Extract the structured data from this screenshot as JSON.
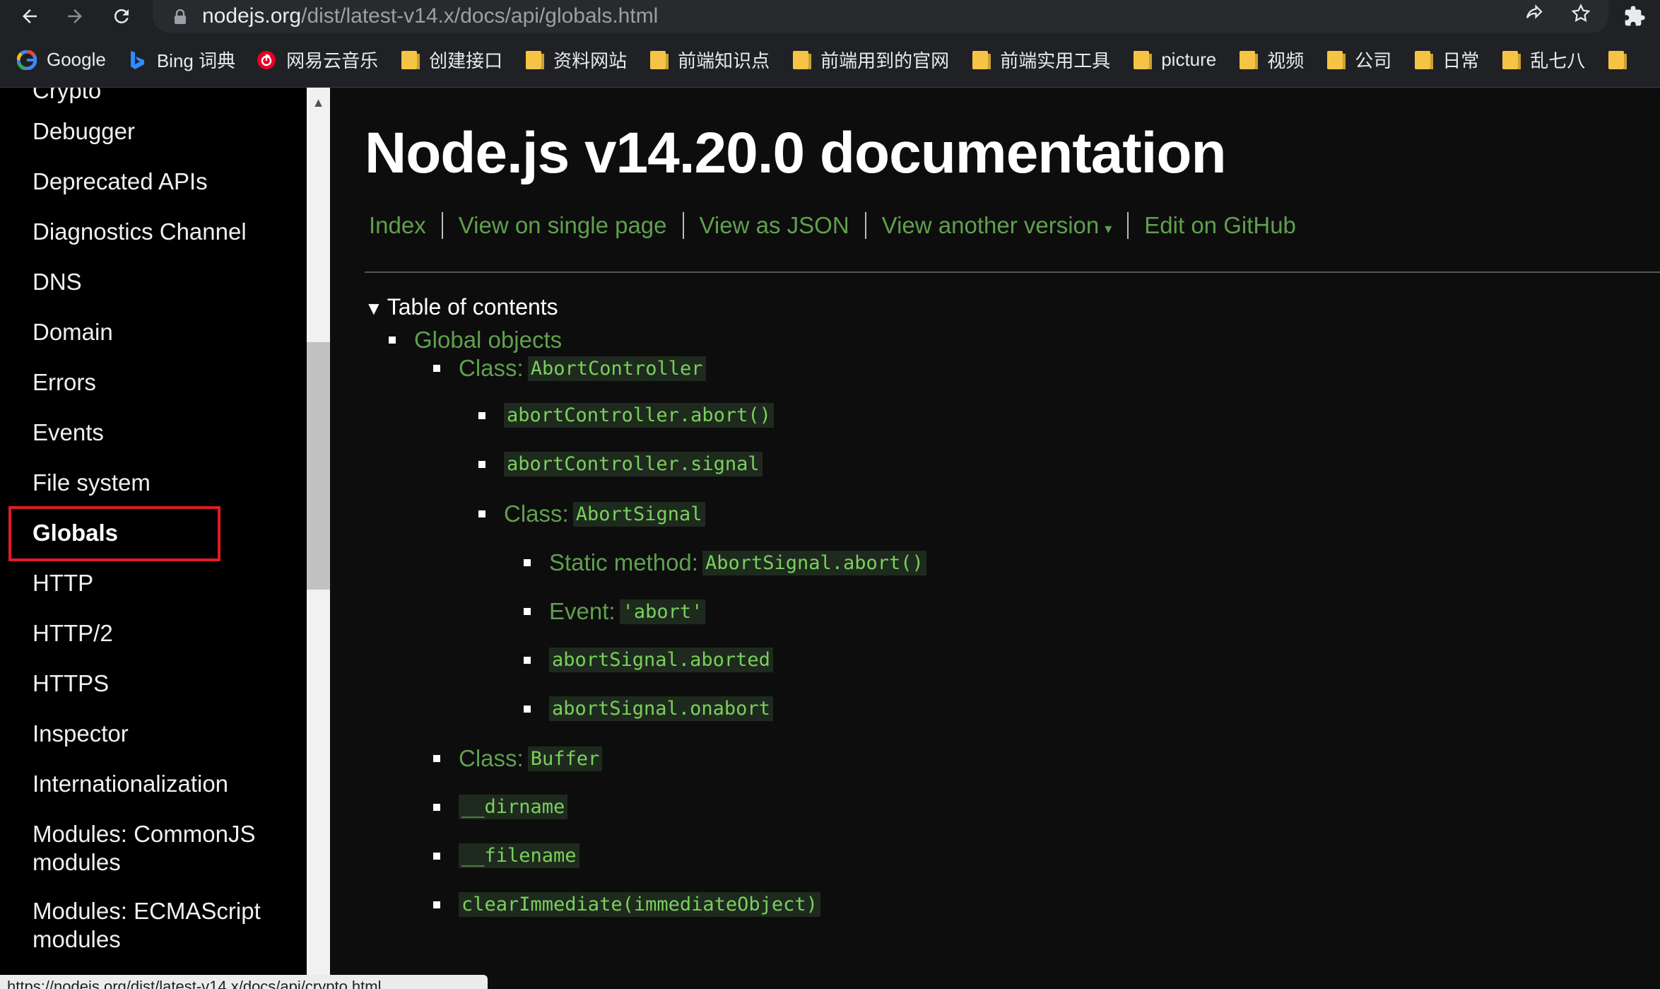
{
  "browser": {
    "back_icon": "arrow-left-icon",
    "forward_icon": "arrow-right-icon",
    "reload_icon": "reload-icon",
    "url_host": "nodejs.org",
    "url_path": "/dist/latest-v14.x/docs/api/globals.html",
    "share_icon": "share-icon",
    "star_icon": "star-icon",
    "extensions_icon": "puzzle-icon"
  },
  "bookmarks": [
    {
      "label": "Google",
      "icon": "google-icon"
    },
    {
      "label": "Bing 词典",
      "icon": "bing-icon"
    },
    {
      "label": "网易云音乐",
      "icon": "netease-music-icon"
    },
    {
      "label": "创建接口",
      "icon": "folder-icon"
    },
    {
      "label": "资料网站",
      "icon": "folder-icon"
    },
    {
      "label": "前端知识点",
      "icon": "folder-icon"
    },
    {
      "label": "前端用到的官网",
      "icon": "folder-icon"
    },
    {
      "label": "前端实用工具",
      "icon": "folder-icon"
    },
    {
      "label": "picture",
      "icon": "folder-icon"
    },
    {
      "label": "视频",
      "icon": "folder-icon"
    },
    {
      "label": "公司",
      "icon": "folder-icon"
    },
    {
      "label": "日常",
      "icon": "folder-icon"
    },
    {
      "label": "乱七八",
      "icon": "folder-icon"
    }
  ],
  "sidebar": {
    "cut_item": "Crypto",
    "items": [
      "Debugger",
      "Deprecated APIs",
      "Diagnostics Channel",
      "DNS",
      "Domain",
      "Errors",
      "Events",
      "File system",
      "Globals",
      "HTTP",
      "HTTP/2",
      "HTTPS",
      "Inspector",
      "Internationalization"
    ],
    "modules_commonjs_line1": "Modules: CommonJS",
    "modules_commonjs_line2": "modules",
    "modules_esm_line1": "Modules: ECMAScript",
    "modules_esm_line2": "modules",
    "active": "Globals"
  },
  "main": {
    "title": "Node.js v14.20.0 documentation",
    "links": {
      "index": "Index",
      "single_page": "View on single page",
      "json": "View as JSON",
      "another_version": "View another version",
      "another_version_caret": "▾",
      "github": "Edit on GitHub"
    },
    "toc_toggle": "Table of contents",
    "toc_triangle": "▼",
    "toc": {
      "global_objects": "Global objects",
      "class_label": "Class:",
      "abort_controller": "AbortController",
      "abort_controller_abort": "abortController.abort()",
      "abort_controller_signal": "abortController.signal",
      "abort_signal": "AbortSignal",
      "static_method_label": "Static method:",
      "abort_signal_abort": "AbortSignal.abort()",
      "event_label": "Event:",
      "abort_event": "'abort'",
      "abort_signal_aborted": "abortSignal.aborted",
      "abort_signal_onabort": "abortSignal.onabort",
      "buffer": "Buffer",
      "dirname": "__dirname",
      "filename": "__filename",
      "clear_immediate": "clearImmediate(immediateObject)"
    }
  },
  "status_bar": "https://nodejs.org/dist/latest-v14.x/docs/api/crypto.html"
}
